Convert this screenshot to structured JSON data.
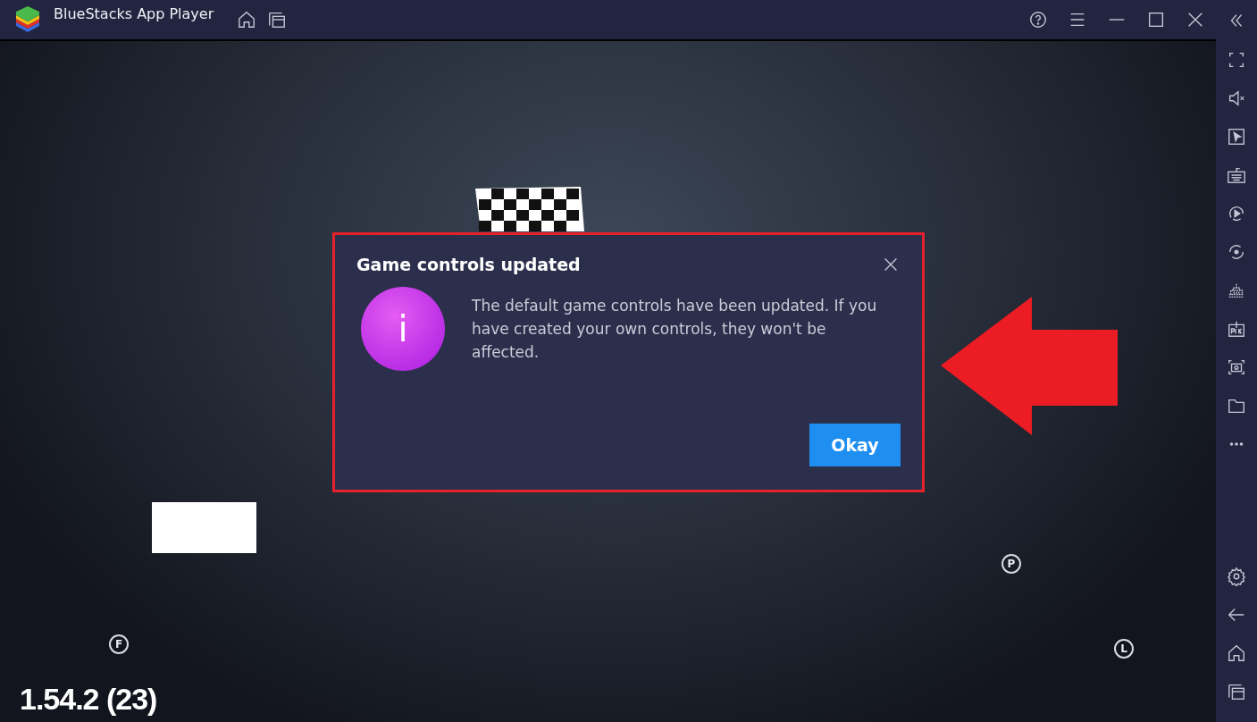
{
  "window": {
    "title": "BlueStacks App Player"
  },
  "dialog": {
    "title": "Game controls updated",
    "message": "The default game controls have been updated. If you have created your own controls, they won't be affected.",
    "button": "Okay",
    "icon_glyph": "i"
  },
  "game": {
    "markers": [
      {
        "label": "P"
      },
      {
        "label": "F"
      },
      {
        "label": "L"
      }
    ],
    "version": "1.54.2 (23)"
  }
}
